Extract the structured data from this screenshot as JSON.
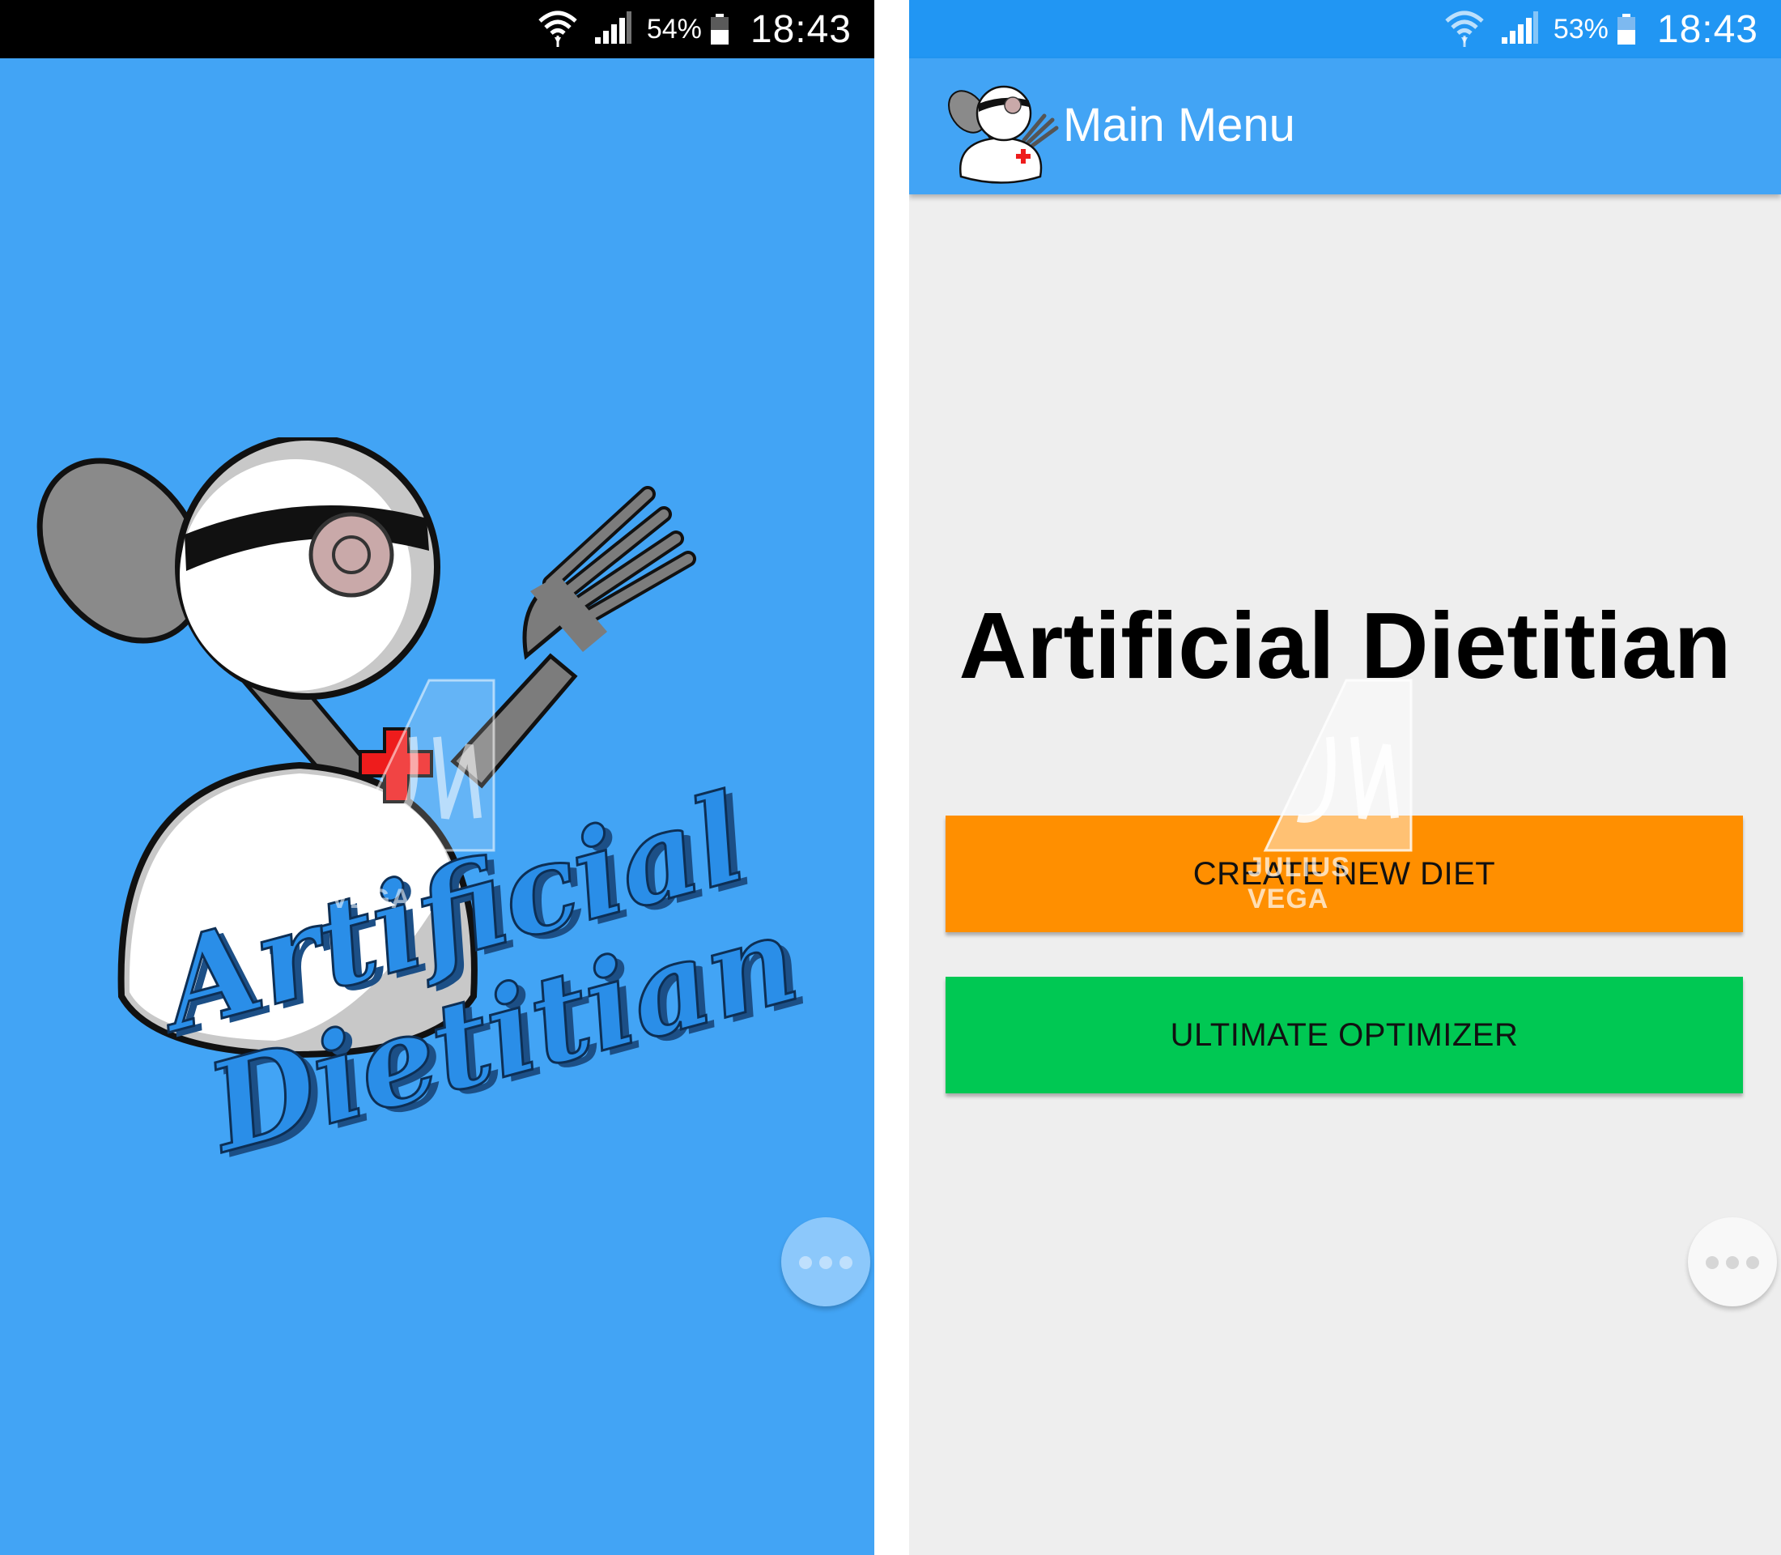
{
  "left_screen": {
    "status_bar": {
      "battery_percent": "54%",
      "time": "18:43",
      "icons": [
        "wifi-icon",
        "signal-icon",
        "battery-icon"
      ]
    },
    "splash_logo": {
      "icon": "artificial-dietitian-logo",
      "line1": "Artificial",
      "line2": "Dietitian"
    },
    "watermark": "JULIUS VEGA",
    "floating_button_icon": "more-dots-icon"
  },
  "right_screen": {
    "status_bar": {
      "battery_percent": "53%",
      "time": "18:43",
      "icons": [
        "wifi-icon",
        "signal-icon",
        "battery-icon"
      ]
    },
    "app_bar": {
      "title": "Main Menu",
      "logo_icon": "artificial-dietitian-logo"
    },
    "heading": "Artificial Dietitian",
    "buttons": [
      {
        "label": "CREATE NEW DIET",
        "color": "#ff8f00"
      },
      {
        "label": "ULTIMATE OPTIMIZER",
        "color": "#00c853"
      }
    ],
    "watermark": "JULIUS VEGA",
    "floating_button_icon": "more-dots-icon"
  },
  "colors": {
    "splash_background": "#42a4f5",
    "status_bar_left": "#000000",
    "status_bar_right": "#2196f3",
    "app_bar": "#42a4f5",
    "menu_background": "#eeeeee",
    "logo_text_blue": "#2a8ee8",
    "cross_red": "#ee1c1c"
  }
}
